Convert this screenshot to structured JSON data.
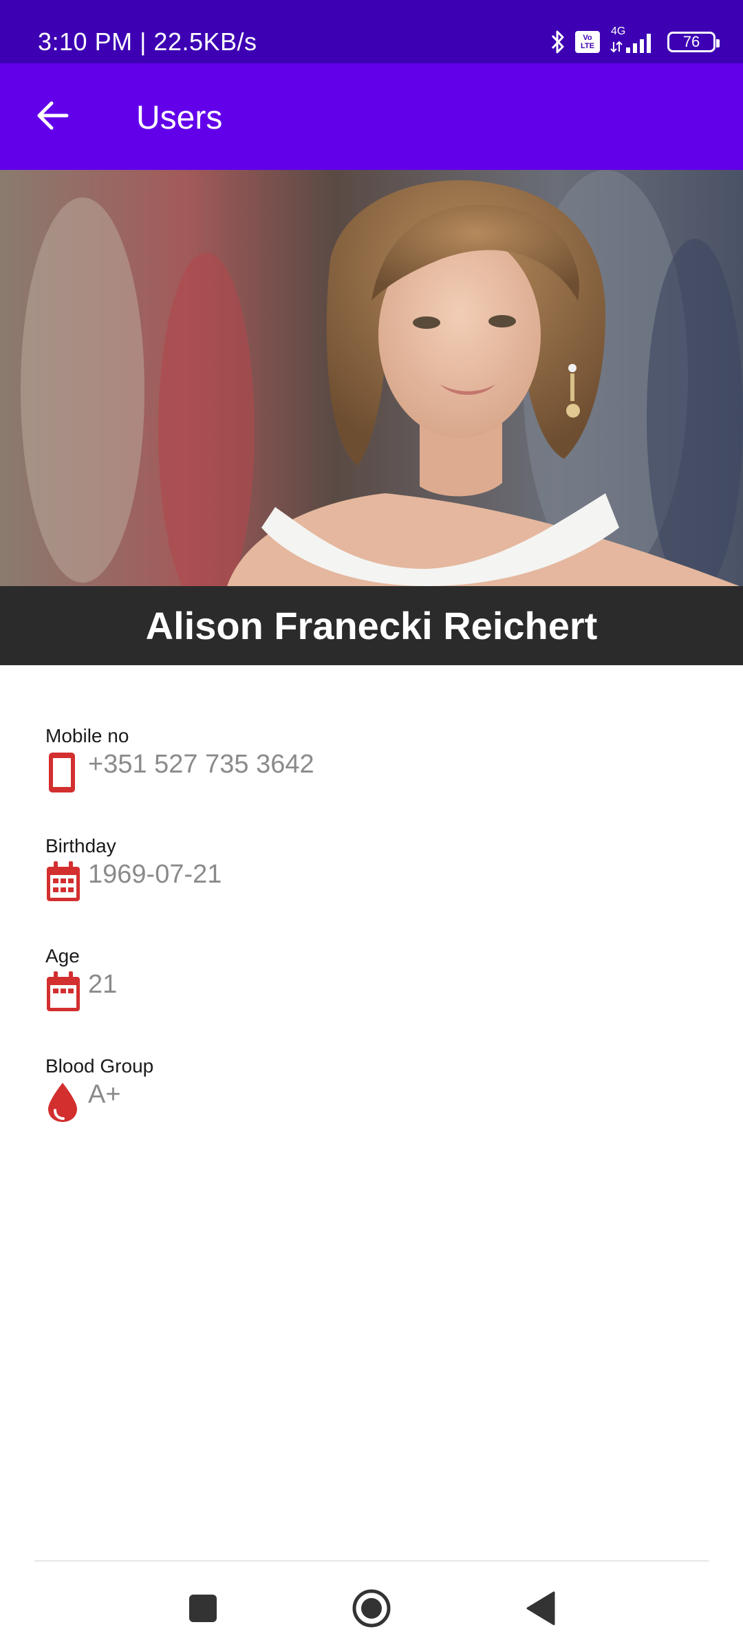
{
  "status_bar": {
    "time": "3:10 PM | 22.5KB/s",
    "network": "4G",
    "volte_badge_line1": "Vo",
    "volte_badge_line2": "LTE",
    "battery": "76",
    "icons": [
      "bluetooth-icon",
      "volte-icon",
      "signal-icon",
      "battery-icon"
    ]
  },
  "app_bar": {
    "title": "Users",
    "back_icon": "arrow-back-icon",
    "background": "#6200ea"
  },
  "profile": {
    "name": "Alison Franecki Reichert",
    "photo": "profile-photo"
  },
  "details": [
    {
      "label": "Mobile no",
      "value": "+351 527 735 3642",
      "icon": "phone-icon"
    },
    {
      "label": "Birthday",
      "value": "1969-07-21",
      "icon": "calendar-icon"
    },
    {
      "label": "Age",
      "value": "21",
      "icon": "calendar-icon"
    },
    {
      "label": "Blood Group",
      "value": "A+",
      "icon": "blood-drop-icon"
    }
  ],
  "icon_color": "#d32f2f",
  "nav_bar": {
    "buttons": [
      "recent-apps-icon",
      "home-icon",
      "back-icon"
    ]
  }
}
